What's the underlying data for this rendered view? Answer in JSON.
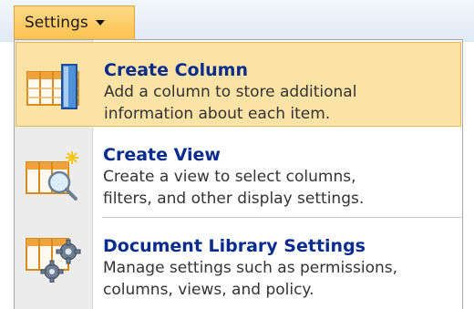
{
  "toolbar": {
    "settings_label": "Settings"
  },
  "menu": {
    "items": [
      {
        "title": "Create Column",
        "desc_line1": "Add a column to store additional",
        "desc_line2": "information about each item.",
        "icon": "create-column-icon"
      },
      {
        "title": "Create View",
        "desc_line1": "Create a view to select columns,",
        "desc_line2": "filters, and other display settings.",
        "icon": "create-view-icon"
      },
      {
        "title": "Document Library Settings",
        "desc_line1": "Manage settings such as permissions,",
        "desc_line2": "columns, views, and policy.",
        "icon": "library-settings-icon"
      }
    ]
  },
  "colors": {
    "highlight": "#fbe2a5",
    "title_blue": "#0a2c8c",
    "button": "#fbc24d"
  }
}
